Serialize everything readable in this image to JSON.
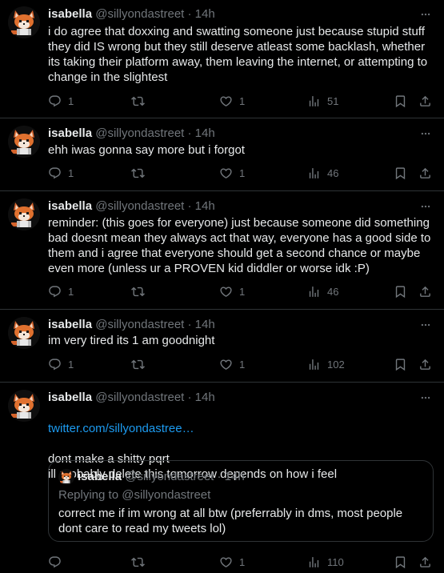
{
  "tweets": [
    {
      "name": "isabella",
      "handle": "@sillyondastreet",
      "sep": "·",
      "time": "14h",
      "text": "i do agree that doxxing and swatting someone just because stupid stuff they did IS wrong but they still deserve atleast some backlash, whether its taking their platform away, them leaving the internet, or attempting to change in the slightest",
      "replies": "1",
      "retweets": "",
      "likes": "1",
      "views": "51"
    },
    {
      "name": "isabella",
      "handle": "@sillyondastreet",
      "sep": "·",
      "time": "14h",
      "text": "ehh iwas gonna say more but i forgot",
      "replies": "1",
      "retweets": "",
      "likes": "1",
      "views": "46"
    },
    {
      "name": "isabella",
      "handle": "@sillyondastreet",
      "sep": "·",
      "time": "14h",
      "text": "reminder: (this goes for everyone) just because someone did something bad doesnt mean they always act that way, everyone has a good side to them and i agree that everyone should get a second chance or maybe even more (unless ur a PROVEN kid diddler or worse idk :P)",
      "replies": "1",
      "retweets": "",
      "likes": "1",
      "views": "46"
    },
    {
      "name": "isabella",
      "handle": "@sillyondastreet",
      "sep": "·",
      "time": "14h",
      "text": "im very tired its 1 am goodnight",
      "replies": "1",
      "retweets": "",
      "likes": "1",
      "views": "102"
    },
    {
      "name": "isabella",
      "handle": "@sillyondastreet",
      "sep": "·",
      "time": "14h",
      "link": "twitter.com/sillyondastree…",
      "text": "dont make a shitty pqrt\nill probably delete this tomorrow depends on how i feel",
      "replies": "",
      "retweets": "",
      "likes": "1",
      "views": "110",
      "quote": {
        "name": "isabella",
        "handle": "@sillyondastreet",
        "sep": "·",
        "time": "14h",
        "replying": "Replying to @sillyondastreet",
        "text": "correct me if im wrong at all btw (preferrably in dms, most people dont care to read my tweets lol)"
      }
    }
  ],
  "colors": {
    "accent": "#1d9bf0",
    "muted": "#71767b",
    "text": "#e7e9ea",
    "border": "#2f3336"
  },
  "icons": [
    "reply-icon",
    "retweet-icon",
    "like-icon",
    "views-icon",
    "bookmark-icon",
    "share-icon",
    "more-icon"
  ]
}
